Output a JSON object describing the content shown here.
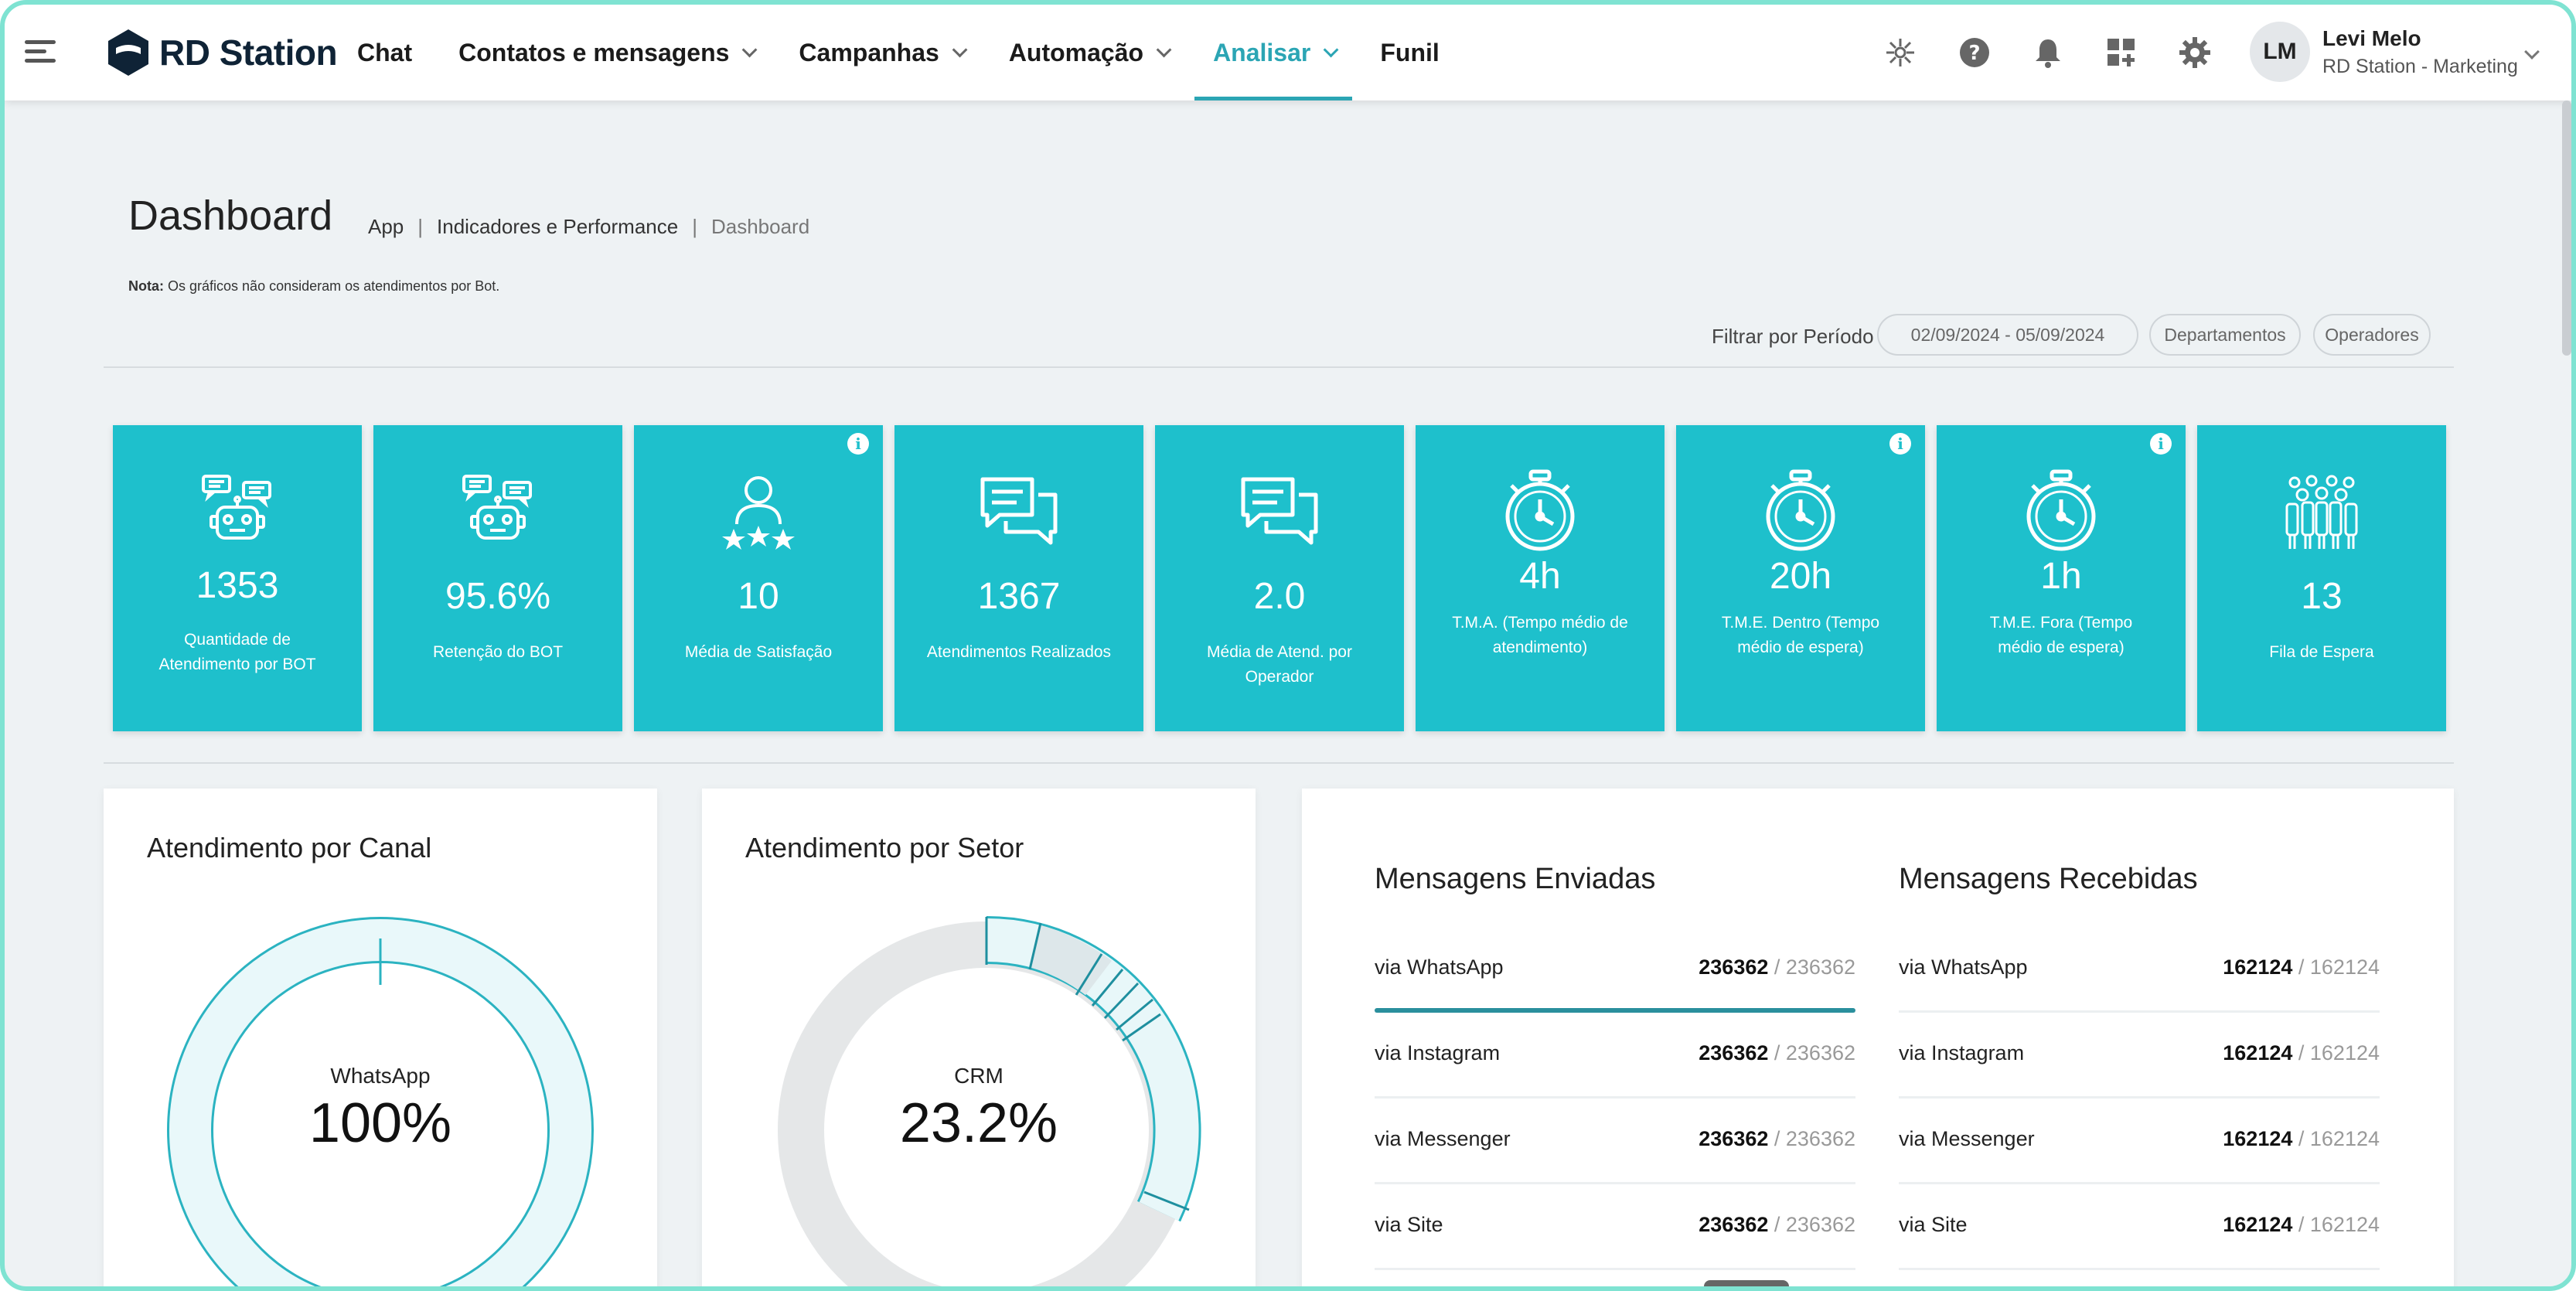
{
  "header": {
    "logo_text": "RD Station",
    "nav": [
      {
        "label": "Chat",
        "dropdown": false,
        "active": false
      },
      {
        "label": "Contatos e mensagens",
        "dropdown": true,
        "active": false
      },
      {
        "label": "Campanhas",
        "dropdown": true,
        "active": false
      },
      {
        "label": "Automação",
        "dropdown": true,
        "active": false
      },
      {
        "label": "Analisar",
        "dropdown": true,
        "active": true
      },
      {
        "label": "Funil",
        "dropdown": false,
        "active": false
      }
    ],
    "icons": [
      "integrations-icon",
      "help-icon",
      "notifications-icon",
      "apps-add-icon",
      "settings-icon"
    ],
    "user": {
      "initials": "LM",
      "name": "Levi Melo",
      "org": "RD Station - Marketing"
    }
  },
  "page": {
    "title": "Dashboard",
    "breadcrumb": [
      "App",
      "Indicadores e Performance",
      "Dashboard"
    ],
    "note_bold": "Nota:",
    "note_text": "Os gráficos não consideram os atendimentos por Bot.",
    "filter_label": "Filtrar por Período",
    "date_range": "02/09/2024 - 05/09/2024",
    "filter_departments": "Departamentos",
    "filter_operators": "Operadores"
  },
  "kpis": [
    {
      "value": "1353",
      "label": "Quantidade de Atendimento por BOT",
      "icon": "bot-chat-icon",
      "info": false
    },
    {
      "value": "95.6%",
      "label": "Retenção do BOT",
      "icon": "bot-chat-icon",
      "info": false
    },
    {
      "value": "10",
      "label": "Média de Satisfação",
      "icon": "user-stars-icon",
      "info": true
    },
    {
      "value": "1367",
      "label": "Atendimentos Realizados",
      "icon": "chat-bubbles-icon",
      "info": false
    },
    {
      "value": "2.0",
      "label": "Média de Atend. por Operador",
      "icon": "chat-bubbles-icon",
      "info": false
    },
    {
      "value": "4h",
      "label": "T.M.A. (Tempo médio de atendimento)",
      "icon": "stopwatch-icon",
      "info": false
    },
    {
      "value": "20h",
      "label": "T.M.E. Dentro (Tempo médio de espera)",
      "icon": "stopwatch-icon",
      "info": true
    },
    {
      "value": "1h",
      "label": "T.M.E. Fora (Tempo médio de espera)",
      "icon": "stopwatch-icon",
      "info": true
    },
    {
      "value": "13",
      "label": "Fila de Espera",
      "icon": "queue-people-icon",
      "info": false
    }
  ],
  "canal": {
    "title": "Atendimento por Canal",
    "center_label": "WhatsApp",
    "center_value": "100%"
  },
  "setor": {
    "title": "Atendimento por Setor",
    "center_label": "CRM",
    "center_value": "23.2%"
  },
  "mensagens": {
    "enviadas": {
      "title": "Mensagens Enviadas",
      "rows": [
        {
          "channel": "via WhatsApp",
          "value": "236362",
          "total": "/ 236362",
          "fill": 1.0
        },
        {
          "channel": "via Instagram",
          "value": "236362",
          "total": "/ 236362",
          "fill": 0
        },
        {
          "channel": "via Messenger",
          "value": "236362",
          "total": "/ 236362",
          "fill": 0
        },
        {
          "channel": "via Site",
          "value": "236362",
          "total": "/ 236362",
          "fill": 0
        }
      ]
    },
    "recebidas": {
      "title": "Mensagens Recebidas",
      "rows": [
        {
          "channel": "via WhatsApp",
          "value": "162124",
          "total": "/ 162124"
        },
        {
          "channel": "via Instagram",
          "value": "162124",
          "total": "/ 162124"
        },
        {
          "channel": "via Messenger",
          "value": "162124",
          "total": "/ 162124"
        },
        {
          "channel": "via Site",
          "value": "162124",
          "total": "/ 162124"
        }
      ]
    }
  },
  "colors": {
    "accent": "#2ba5b4",
    "card": "#1ec0cc",
    "background": "#eef2f4"
  }
}
